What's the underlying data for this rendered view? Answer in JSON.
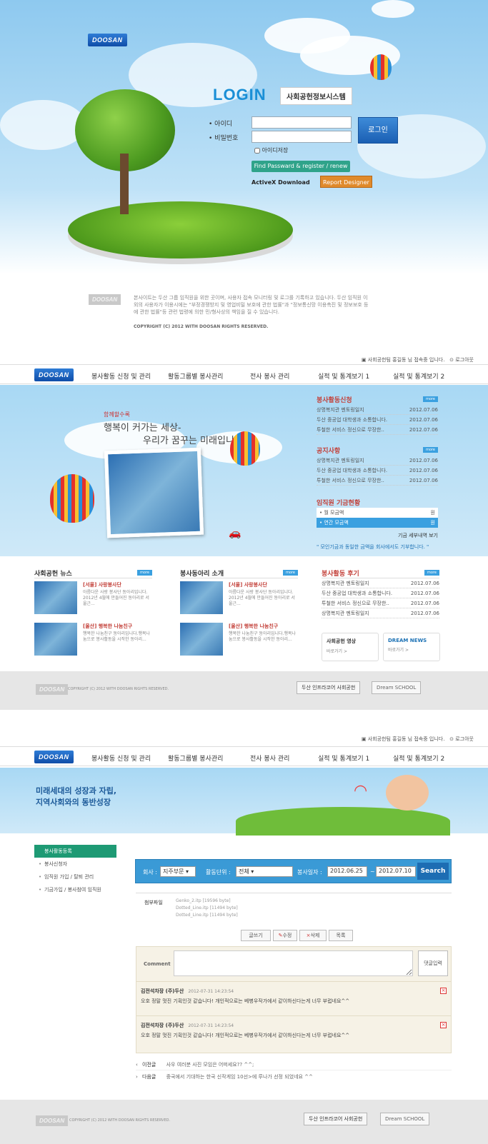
{
  "login": {
    "title": "LOGIN",
    "subtitle": "사회공헌정보시스템",
    "id_label": "• 아이디",
    "pw_label": "• 비밀번호",
    "login_button": "로그인",
    "save_id_label": "아이디저장",
    "find_button": "Find Passward & register / renew",
    "activex_label": "ActiveX Download",
    "report_button": "Report Designer",
    "logo": "DOOSAN",
    "disclaimer": "본사이트는 두산 그룹 임직원을 위한 곳이며, 사용자 접속 모니터링 및 로그를 기록하고 있습니다. 두산 임직원 이외의 사용자가 이용시에는 \"부정경쟁방지 및 영업비밀 보호에 관한 법률\"과 \"정보통신망 이용촉진 및 정보보호 등에 관한 법률\"등 관련 법령에 의한 민/형사상의 책임을 질 수 있습니다.",
    "copyright": "COPYRIGHT (C) 2012 WITH DOOSAN RIGHTS RESERVED."
  },
  "main": {
    "logo": "DOOSAN",
    "user_info": "사회공헌팀 홍길동 님 접속중 입니다.",
    "logout": "로그아웃",
    "nav": [
      "봉사활동 신청 및 관리",
      "활동그룹별 봉사관리",
      "전사 봉사 관리",
      "실적 및 통계보기 1",
      "실적 및 통계보기 2"
    ],
    "hero": {
      "small": "함께할수록",
      "line1": "행복이 커가는 세상-",
      "line2": "우리가 꿈꾸는 미래입니다"
    },
    "volunteer_apply": {
      "title": "봉사활동신청",
      "more": "more",
      "items": [
        {
          "text": "상명복지관 멘토링일지",
          "date": "2012.07.06"
        },
        {
          "text": "두산 중공업 대학생과 소통합니다.",
          "date": "2012.07.06"
        },
        {
          "text": "투철한 서비스 정신으로 무장한..",
          "date": "2012.07.06"
        }
      ]
    },
    "notice": {
      "title": "공지사항",
      "more": "more",
      "items": [
        {
          "text": "상명복지관 멘토링일지",
          "date": "2012.07.06"
        },
        {
          "text": "두산 중공업 대학생과 소통합니다.",
          "date": "2012.07.06"
        },
        {
          "text": "투철한 서비스 정신으로 무장한..",
          "date": "2012.07.06"
        }
      ]
    },
    "fund": {
      "title": "임직원 기금현황",
      "monthly_label": "• 월 모금액",
      "monthly_unit": "원",
      "yearly_label": "• 연간 모금액",
      "yearly_unit": "원",
      "detail_link": "기금 세부내역 보기",
      "quote": "\" 모인기금과 동일한 금액을 회사에서도 기부합니다. \""
    },
    "csr_news": {
      "title": "사회공헌 뉴스",
      "more": "more",
      "items": [
        {
          "head": "[서울] 사랑봉사단",
          "body": "아름다운 사랑 봉사단 동아리입니다. 2012년 4월에 만들어진 동아리로 서울근..."
        },
        {
          "head": "[울산] 행복한 나눔친구",
          "body": "행복한 나눔친구 동아리입니다.행복나눔으로 봉사활동을 시작한 동아리..."
        }
      ]
    },
    "club": {
      "title": "봉사동아리 소개",
      "more": "more",
      "items": [
        {
          "head": "[서울] 사랑봉사단",
          "body": "아름다운 사랑 봉사단 동아리입니다. 2012년 4월에 만들어진 동아리로 서울근..."
        },
        {
          "head": "[울산] 행복한 나눔친구",
          "body": "행복한 나눔친구 동아리입니다.행복나눔으로 봉사활동을 시작한 동아리..."
        }
      ]
    },
    "review": {
      "title": "봉사활동 후기",
      "more": "more",
      "items": [
        {
          "text": "상명복지관 멘토링일지",
          "date": "2012.07.06"
        },
        {
          "text": "두산 중공업 대학생과 소통합니다.",
          "date": "2012.07.06"
        },
        {
          "text": "투철한 서비스 정신으로 무장한..",
          "date": "2012.07.06"
        },
        {
          "text": "상명복지관 멘토링일지",
          "date": "2012.07.06"
        }
      ]
    },
    "video_box": {
      "title": "사회공헌 영상",
      "link": "바로가기 >"
    },
    "dream_box": {
      "title": "DREAM NEWS",
      "link": "바로가기 >"
    },
    "footer": {
      "copyright": "COPYRIGHT (C) 2012 WITH DOOSAN RIGHTS RESERVED.",
      "btn1": "두산 인프라코어 사회공헌",
      "btn2": "Dream SCHOOL"
    }
  },
  "sub": {
    "logo": "DOOSAN",
    "user_info": "사회공헌팀 홍길동 님 접속중 입니다.",
    "logout": "로그아웃",
    "nav": [
      "봉사활동 신청 및 관리",
      "활동그룹별 봉사관리",
      "전사 봉사 관리",
      "실적 및 통계보기 1",
      "실적 및 통계보기 2"
    ],
    "banner": {
      "line1": "미래세대의 성장과 자립,",
      "line2": "지역사회와의 동반성장"
    },
    "side": [
      "봉사활동등록",
      "봉사신청자",
      "임직원 가입 / 탈퇴 관리",
      "기금가입 / 봉사참여 임직원"
    ],
    "search": {
      "field1_label": "회사 :",
      "field1_value": "지주부문",
      "field2_label": "활동단위 :",
      "field2_value": "전체",
      "date_label": "봉사일자 :",
      "date_from": "2012.06.25",
      "date_sep": "~",
      "date_to": "2012.07.10",
      "button": "Search"
    },
    "attach": {
      "label": "첨부파일",
      "files": [
        "Genko_2.itp  [19596 byte]",
        "Dotted_Line.itp  [11494 byte]",
        "Dotted_Line.itp  [11494 byte]"
      ]
    },
    "buttons": {
      "write": "글쓰기",
      "edit": "수정",
      "delete": "삭제",
      "list": "목록"
    },
    "comment": {
      "label": "Comment",
      "submit": "댓글입력",
      "items": [
        {
          "who": "김전석차장 (주)두산",
          "when": "2012-07-31 14:23:54",
          "text": "오호 정말 멋진 기획인것 같습니다! 개인적으로는 베병우작가에서 같이하신다는게 너무 부럽네요^^"
        },
        {
          "who": "김전석차장 (주)두산",
          "when": "2012-07-31 14:23:54",
          "text": "오호 정말 멋진 기획인것 같습니다! 개인적으로는 베병우작가에서 같이하신다는게 너무 부럽네요^^"
        }
      ]
    },
    "prev": {
      "label": "이전글",
      "text": "사우 여러분 사진 모임은 어떠세요?? ^^;"
    },
    "next": {
      "label": "다음글",
      "text": "중국에서 기대하는 한국 신작게임 10선>에 루나가 선정 되었네요 ^^"
    },
    "footer": {
      "copyright": "COPYRIGHT (C) 2012 WITH DOOSAN RIGHTS RESERVED.",
      "btn1": "두산 인프라코어 사회공헌",
      "btn2": "Dream SCHOOL"
    }
  }
}
